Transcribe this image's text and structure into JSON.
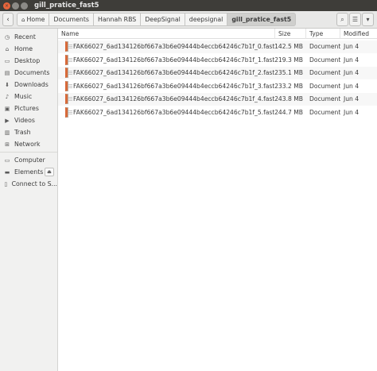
{
  "window": {
    "title": "gill_pratice_fast5",
    "close_glyph": "×",
    "min_glyph": "",
    "max_glyph": ""
  },
  "toolbar": {
    "back_glyph": "‹",
    "search_glyph": "⌕",
    "view_glyph": "☰",
    "menu_glyph": "▾",
    "breadcrumbs": [
      "Home",
      "Documents",
      "Hannah RBS",
      "DeepSignal",
      "deepsignal",
      "gill_pratice_fast5"
    ],
    "home_glyph": "⌂"
  },
  "sidebar": {
    "items": [
      {
        "label": "Recent",
        "icon": "clock-icon",
        "glyph": "◷"
      },
      {
        "label": "Home",
        "icon": "home-icon",
        "glyph": "⌂"
      },
      {
        "label": "Desktop",
        "icon": "desktop-icon",
        "glyph": "▭"
      },
      {
        "label": "Documents",
        "icon": "document-icon",
        "glyph": "▤"
      },
      {
        "label": "Downloads",
        "icon": "download-icon",
        "glyph": "⬇"
      },
      {
        "label": "Music",
        "icon": "music-icon",
        "glyph": "♪"
      },
      {
        "label": "Pictures",
        "icon": "picture-icon",
        "glyph": "▣"
      },
      {
        "label": "Videos",
        "icon": "video-icon",
        "glyph": "▶"
      },
      {
        "label": "Trash",
        "icon": "trash-icon",
        "glyph": "▥"
      },
      {
        "label": "Network",
        "icon": "network-icon",
        "glyph": "⊞"
      }
    ],
    "devices": [
      {
        "label": "Computer",
        "icon": "computer-icon",
        "glyph": "▭"
      },
      {
        "label": "Elements",
        "icon": "drive-icon",
        "glyph": "▬"
      },
      {
        "label": "Connect to S...",
        "icon": "server-icon",
        "glyph": "▯"
      }
    ],
    "eject_glyph": "⏏"
  },
  "columns": {
    "name": "Name",
    "size": "Size",
    "type": "Type",
    "modified": "Modified"
  },
  "files": [
    {
      "name": "FAK66027_6ad134126bf667a3b6e09444b4eccb64246c7b1f_0.fast5",
      "size": "142.5 MB",
      "type": "Document",
      "modified": "Jun 4"
    },
    {
      "name": "FAK66027_6ad134126bf667a3b6e09444b4eccb64246c7b1f_1.fast5",
      "size": "219.3 MB",
      "type": "Document",
      "modified": "Jun 4"
    },
    {
      "name": "FAK66027_6ad134126bf667a3b6e09444b4eccb64246c7b1f_2.fast5",
      "size": "235.1 MB",
      "type": "Document",
      "modified": "Jun 4"
    },
    {
      "name": "FAK66027_6ad134126bf667a3b6e09444b4eccb64246c7b1f_3.fast5",
      "size": "233.2 MB",
      "type": "Document",
      "modified": "Jun 4"
    },
    {
      "name": "FAK66027_6ad134126bf667a3b6e09444b4eccb64246c7b1f_4.fast5",
      "size": "243.8 MB",
      "type": "Document",
      "modified": "Jun 4"
    },
    {
      "name": "FAK66027_6ad134126bf667a3b6e09444b4eccb64246c7b1f_5.fast5",
      "size": "244.7 MB",
      "type": "Document",
      "modified": "Jun 4"
    }
  ],
  "colors": {
    "accent": "#e9653b",
    "titlebar": "#3e3d39"
  }
}
